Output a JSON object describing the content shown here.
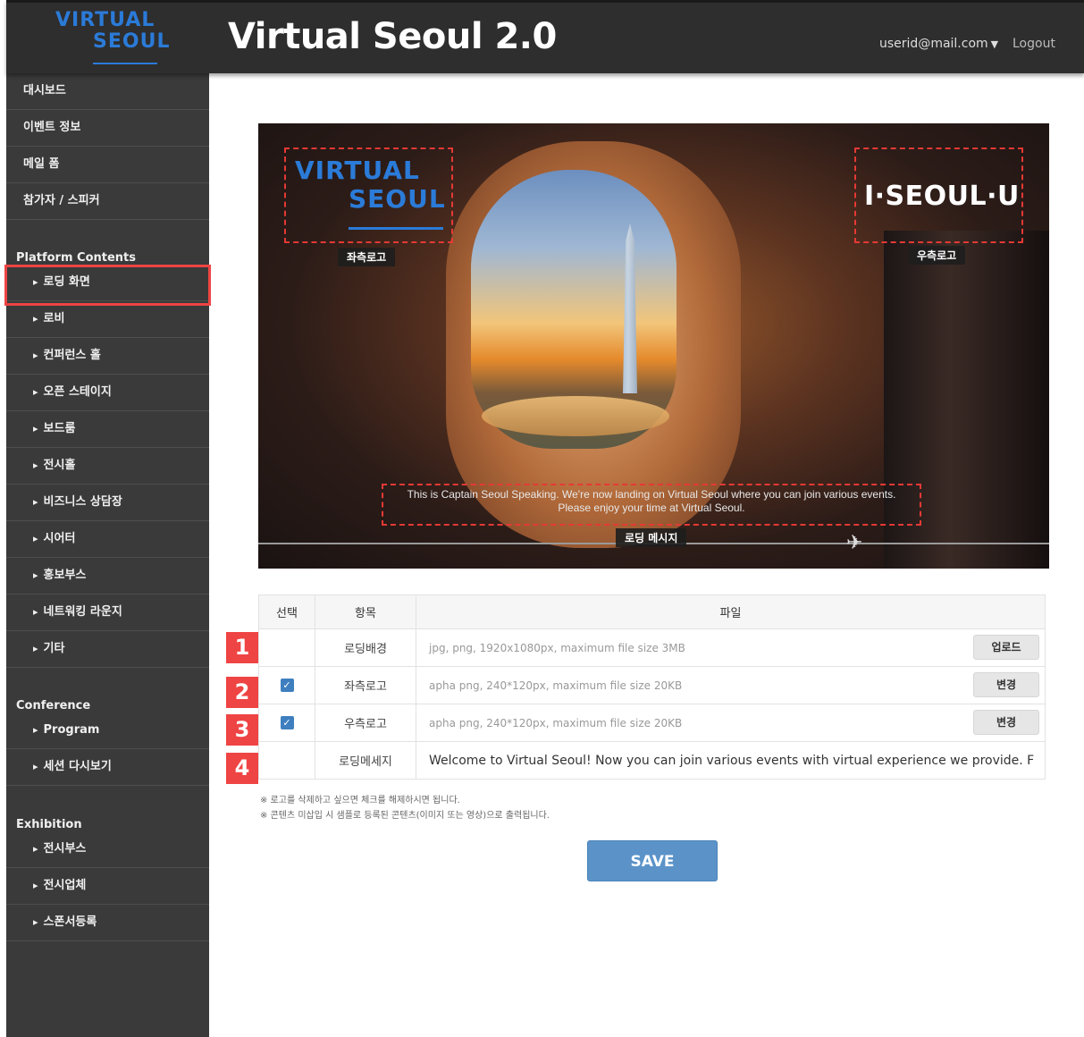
{
  "header": {
    "logo_line1": "VIRTUAL",
    "logo_line2": "SEOUL",
    "title": "Virtual Seoul 2.0",
    "user": "userid@mail.com",
    "logout": "Logout"
  },
  "sidebar": {
    "top_items": [
      "대시보드",
      "이벤트 정보",
      "메일 폼",
      "참가자 / 스피커"
    ],
    "platform_title": "Platform Contents",
    "platform_items": [
      "로딩 화면",
      "로비",
      "컨퍼런스 홀",
      "오픈 스테이지",
      "보드룸",
      "전시홀",
      "비즈니스 상담장",
      "시어터",
      "홍보부스",
      "네트워킹 라운지",
      "기타"
    ],
    "conference_title": "Conference",
    "conference_items": [
      "Program",
      "세션 다시보기"
    ],
    "exhibition_title": "Exhibition",
    "exhibition_items": [
      "전시부스",
      "전시업체",
      "스폰서등록"
    ]
  },
  "preview": {
    "left_logo_line1": "VIRTUAL",
    "left_logo_line2": "SEOUL",
    "left_logo_tag": "좌측로고",
    "right_logo_text": "I·SEOUL·U",
    "right_logo_tag": "우측로고",
    "message_line1": "This is Captain Seoul Speaking. We're now landing on Virtual Seoul where you can join various events.",
    "message_line2": "Please enjoy your time at Virtual Seoul.",
    "message_tag": "로딩 메시지"
  },
  "table": {
    "headers": [
      "선택",
      "항목",
      "파일"
    ],
    "rows": [
      {
        "badge": "1",
        "checked": false,
        "item": "로딩배경",
        "file": "jpg, png, 1920x1080px, maximum file size 3MB",
        "button": "업로드"
      },
      {
        "badge": "2",
        "checked": true,
        "item": "좌측로고",
        "file": "apha png, 240*120px, maximum file size 20KB",
        "button": "변경"
      },
      {
        "badge": "3",
        "checked": true,
        "item": "우측로고",
        "file": "apha png, 240*120px, maximum file size 20KB",
        "button": "변경"
      },
      {
        "badge": "4",
        "checked": false,
        "item": "로딩메세지",
        "file": "Welcome to Virtual Seoul! Now you can join various events with virtual experience we provide. F"
      }
    ]
  },
  "notes": [
    "※ 로고를 삭제하고 싶으면 체크를 해제하시면 됩니다.",
    "※ 콘텐츠 미삽입 시 샘플로 등록된 콘텐츠(이미지 또는 영상)으로 출력됩니다."
  ],
  "save_label": "SAVE",
  "colors": {
    "accent": "#5b93c9",
    "highlight": "#ef4444",
    "sidebar": "#3a3a3a",
    "header": "#2e2e2e"
  }
}
